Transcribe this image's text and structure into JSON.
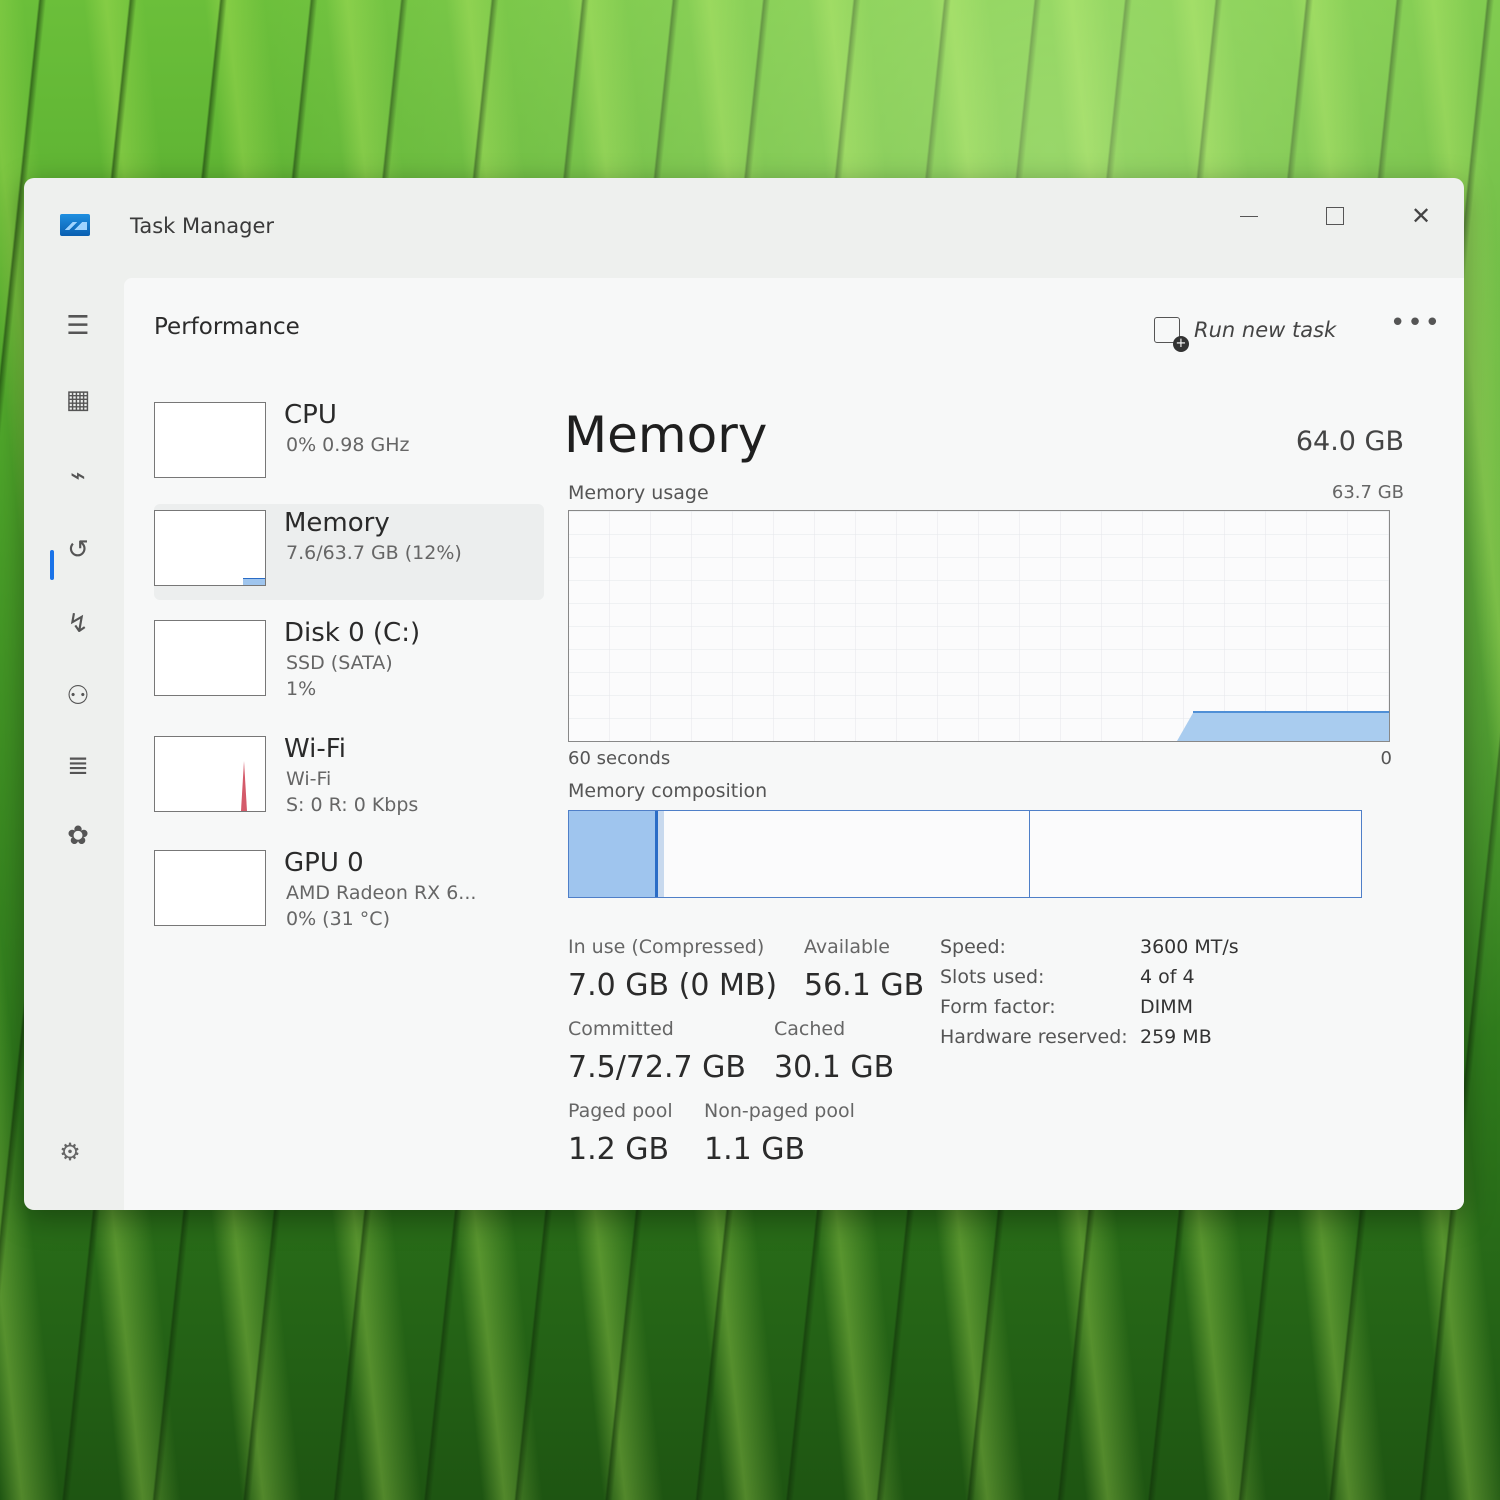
{
  "window": {
    "title": "Task Manager"
  },
  "nav": {
    "items": [
      {
        "icon": "hamburger-menu-icon",
        "glyph": "☰"
      },
      {
        "icon": "processes-icon",
        "glyph": "▦"
      },
      {
        "icon": "performance-icon",
        "glyph": "⌁"
      },
      {
        "icon": "app-history-icon",
        "glyph": "↺"
      },
      {
        "icon": "startup-apps-icon",
        "glyph": "↯"
      },
      {
        "icon": "users-icon",
        "glyph": "⚇"
      },
      {
        "icon": "details-icon",
        "glyph": "≣"
      },
      {
        "icon": "services-icon",
        "glyph": "✿"
      }
    ],
    "settings_icon": "gear-icon",
    "settings_glyph": "⚙"
  },
  "header": {
    "title": "Performance",
    "run_new_task": "Run new task",
    "more": "•••"
  },
  "devices": [
    {
      "name": "CPU",
      "line1": "0% 0.98 GHz",
      "line2": ""
    },
    {
      "name": "Memory",
      "line1": "7.6/63.7 GB (12%)",
      "line2": ""
    },
    {
      "name": "Disk 0 (C:)",
      "line1": "SSD (SATA)",
      "line2": "1%"
    },
    {
      "name": "Wi-Fi",
      "line1": "Wi-Fi",
      "line2": "S: 0 R: 0 Kbps"
    },
    {
      "name": "GPU 0",
      "line1": "AMD Radeon RX 6...",
      "line2": "0% (31 °C)"
    }
  ],
  "memory": {
    "title": "Memory",
    "total": "64.0 GB",
    "usage_label": "Memory usage",
    "usage_max": "63.7 GB",
    "axis_left": "60 seconds",
    "axis_right": "0",
    "composition_label": "Memory composition",
    "stats": {
      "in_use_label": "In use (Compressed)",
      "in_use_value": "7.0 GB (0 MB)",
      "available_label": "Available",
      "available_value": "56.1 GB",
      "committed_label": "Committed",
      "committed_value": "7.5/72.7 GB",
      "cached_label": "Cached",
      "cached_value": "30.1 GB",
      "paged_label": "Paged pool",
      "paged_value": "1.2 GB",
      "nonpaged_label": "Non-paged pool",
      "nonpaged_value": "1.1 GB"
    },
    "specs": [
      {
        "label": "Speed:",
        "value": "3600 MT/s"
      },
      {
        "label": "Slots used:",
        "value": "4 of 4"
      },
      {
        "label": "Form factor:",
        "value": "DIMM"
      },
      {
        "label": "Hardware reserved:",
        "value": "259 MB"
      }
    ]
  }
}
